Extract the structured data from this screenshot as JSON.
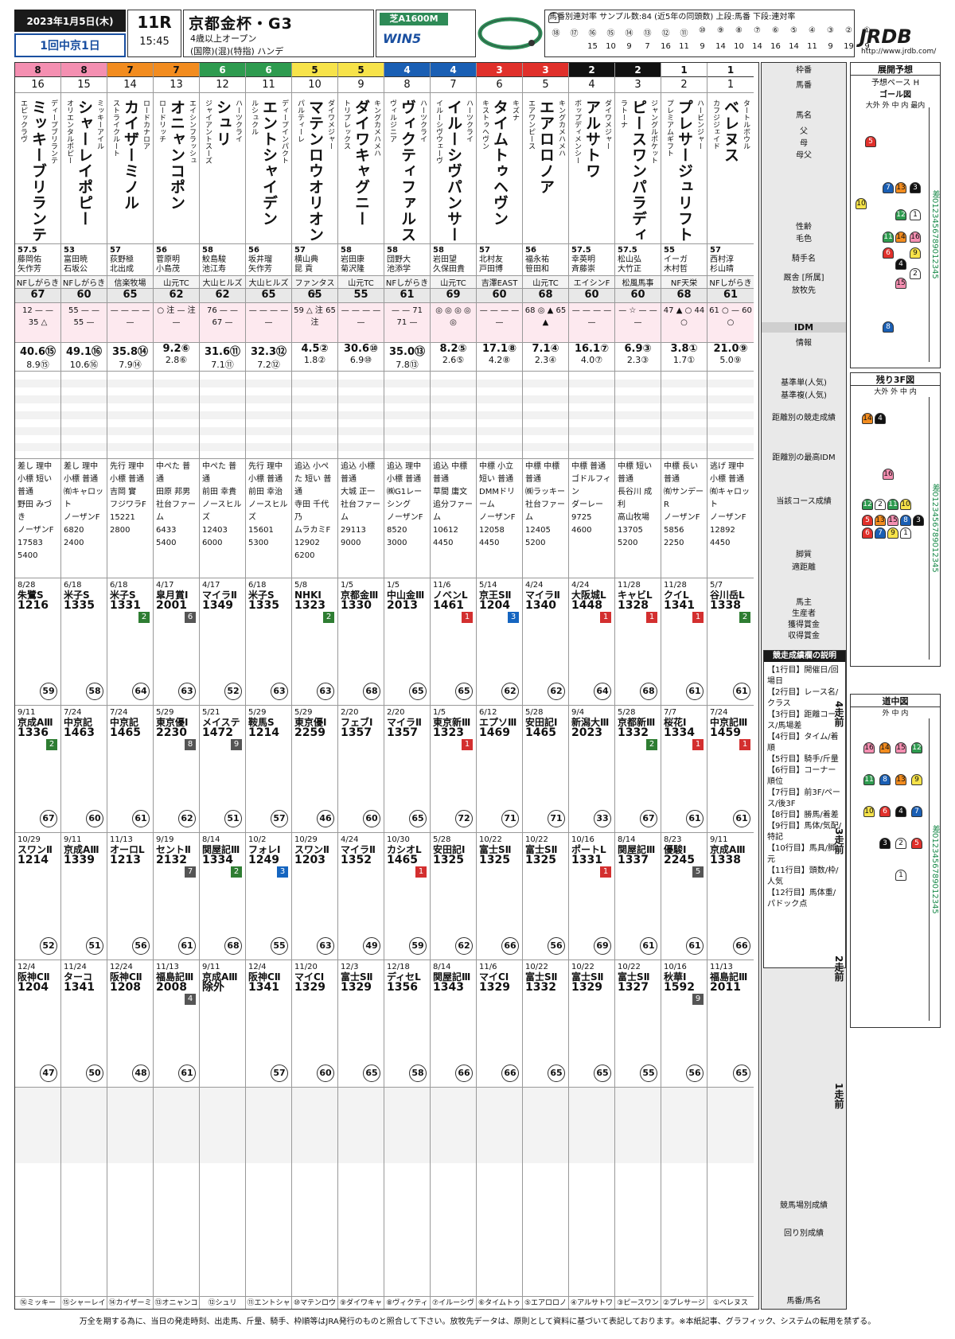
{
  "header": {
    "date": "2023年1月5日(木)",
    "venue": "1回中京1日",
    "race_no": "11R",
    "post_time": "15:45",
    "race_title": "京都金杯・G3",
    "conditions": "4歳以上オープン",
    "conditions2": "(国際)(混)(特指) ハンデ",
    "course": "芝A1600M",
    "win5": "WIN5",
    "stat_caption": "馬番別連対率 サンプル数:84 (近5年の同頭数) 上段:馬番 下段:連対率",
    "stat_nums": [
      "⑱",
      "⑰",
      "⑯",
      "⑮",
      "⑭",
      "⑬",
      "⑫",
      "⑪",
      "⑩",
      "⑨",
      "⑧",
      "⑦",
      "⑥",
      "⑤",
      "④",
      "③",
      "②",
      "①"
    ],
    "stat_vals": [
      "",
      "",
      "15",
      "10",
      "9",
      "7",
      "16",
      "11",
      "9",
      "14",
      "10",
      "14",
      "16",
      "14",
      "11",
      "9",
      "19",
      "9"
    ],
    "logo": "JRDB",
    "url": "http://www.jrdb.com/"
  },
  "horses": [
    {
      "waku": "8",
      "umaban": "16",
      "name": "ミッキーブリランテ",
      "sire": "ディープブリランテ",
      "dam": "エピックラヴ",
      "weight": "57.5",
      "jockey": "藤岡佑",
      "trainer": "矢作芳",
      "stable": "NFしがらき",
      "idm": "67",
      "marks": "12 — — 35 △",
      "odds_w": "40.6⑮",
      "odds_p": "8.9⑮",
      "style": "差し 理中 小標 短い 普通",
      "owner": "野田 みづき",
      "breeder": "ノーザンF",
      "earn1": "17583",
      "earn2": "5400",
      "short": "⑯ミッキー",
      "runs": [
        {
          "date": "8/28",
          "rn": "朱鷺S",
          "time": "1216",
          "pos": "",
          "idx": "59"
        },
        {
          "date": "9/11",
          "rn": "京成AⅢ",
          "time": "1336",
          "pos": "2",
          "idx": "67"
        },
        {
          "date": "10/29",
          "rn": "スワンⅡ",
          "time": "1214",
          "pos": "",
          "idx": "52"
        },
        {
          "date": "12/4",
          "rn": "阪神CⅡ",
          "time": "1204",
          "pos": "",
          "idx": "47"
        }
      ]
    },
    {
      "waku": "8",
      "umaban": "15",
      "name": "シャーレイポピー",
      "sire": "ミッキーアイル",
      "dam": "オリエンタルポピー",
      "weight": "53",
      "jockey": "富田暁",
      "trainer": "石坂公",
      "stable": "NFしがらき",
      "idm": "60",
      "marks": "55 — — 55 —",
      "odds_w": "49.1⑯",
      "odds_p": "10.6⑯",
      "style": "差し 理中 小標 普通",
      "owner": "㈲キャロット",
      "breeder": "ノーザンF",
      "earn1": "6820",
      "earn2": "2400",
      "short": "⑮シャーレイ",
      "runs": [
        {
          "date": "6/18",
          "rn": "米子S",
          "time": "1335",
          "pos": "",
          "idx": "58"
        },
        {
          "date": "7/24",
          "rn": "中京記",
          "time": "1463",
          "pos": "",
          "idx": "60"
        },
        {
          "date": "9/11",
          "rn": "京成AⅢ",
          "time": "1339",
          "pos": "",
          "idx": "51"
        },
        {
          "date": "11/24",
          "rn": "ターコ",
          "time": "1341",
          "pos": "",
          "idx": "50"
        }
      ]
    },
    {
      "waku": "7",
      "umaban": "14",
      "name": "カイザーミノル",
      "sire": "ロードカナロア",
      "dam": "ストライクルート",
      "weight": "57",
      "jockey": "荻野極",
      "trainer": "北出成",
      "stable": "信楽牧場",
      "idm": "65",
      "marks": "— — — — —",
      "odds_w": "35.8⑭",
      "odds_p": "7.9⑭",
      "style": "先行 理中 小標 普通",
      "owner": "吉岡 實",
      "breeder": "フジワラF",
      "earn1": "15221",
      "earn2": "2800",
      "short": "⑭カイザーミ",
      "runs": [
        {
          "date": "6/18",
          "rn": "米子S",
          "time": "1331",
          "pos": "2",
          "idx": "64"
        },
        {
          "date": "7/24",
          "rn": "中京記",
          "time": "1465",
          "pos": "",
          "idx": "61"
        },
        {
          "date": "11/13",
          "rn": "オーロL",
          "time": "1213",
          "pos": "",
          "idx": "56"
        },
        {
          "date": "12/24",
          "rn": "阪神CⅡ",
          "time": "1208",
          "pos": "",
          "idx": "48"
        }
      ]
    },
    {
      "waku": "7",
      "umaban": "13",
      "name": "オニャンコポン",
      "sire": "エイシンフラッシュ",
      "dam": "ロードリッチ",
      "weight": "56",
      "jockey": "菅原明",
      "trainer": "小島茂",
      "stable": "山元TC",
      "idm": "62",
      "marks": "○ 注 — 注 —",
      "odds_w": "9.2⑥",
      "odds_p": "2.8⑥",
      "style": "中ぺた 普通",
      "owner": "田原 邦男",
      "breeder": "社台ファーム",
      "earn1": "6433",
      "earn2": "5400",
      "short": "⑬オニャンコ",
      "runs": [
        {
          "date": "4/17",
          "rn": "皐月賞I",
          "time": "2001",
          "pos": "6",
          "idx": "63"
        },
        {
          "date": "5/29",
          "rn": "東京優I",
          "time": "2230",
          "pos": "8",
          "idx": "62"
        },
        {
          "date": "9/19",
          "rn": "セントⅡ",
          "time": "2132",
          "pos": "7",
          "idx": "61"
        },
        {
          "date": "11/13",
          "rn": "福島記Ⅲ",
          "time": "2008",
          "pos": "4",
          "idx": "61"
        }
      ]
    },
    {
      "waku": "6",
      "umaban": "12",
      "name": "シュリ",
      "sire": "ハーツクライ",
      "dam": "ジャイアントスーズ",
      "weight": "58",
      "jockey": "鮫島駿",
      "trainer": "池江寿",
      "stable": "大山ヒルズ",
      "idm": "62",
      "marks": "76 — — 67 —",
      "odds_w": "31.6⑪",
      "odds_p": "7.1⑪",
      "style": "中ぺた 普通",
      "owner": "前田 幸貴",
      "breeder": "ノースヒルズ",
      "earn1": "12403",
      "earn2": "6000",
      "short": "⑫シュリ",
      "runs": [
        {
          "date": "4/17",
          "rn": "マイラⅡ",
          "time": "1349",
          "pos": "",
          "idx": "52"
        },
        {
          "date": "5/21",
          "rn": "メイステ",
          "time": "1472",
          "pos": "9",
          "idx": "51"
        },
        {
          "date": "8/14",
          "rn": "関屋記Ⅲ",
          "time": "1334",
          "pos": "2",
          "idx": "68"
        },
        {
          "date": "9/11",
          "rn": "京成AⅢ",
          "time": "除外",
          "pos": "",
          "idx": ""
        }
      ]
    },
    {
      "waku": "6",
      "umaban": "11",
      "name": "エントシャイデン",
      "sire": "ディープインパクト",
      "dam": "ルシュクル",
      "weight": "56",
      "jockey": "坂井瑠",
      "trainer": "矢作芳",
      "stable": "大山ヒルズ",
      "idm": "65",
      "marks": "— — — — —",
      "odds_w": "32.3⑫",
      "odds_p": "7.2⑫",
      "style": "先行 理中 小標 普通",
      "owner": "前田 幸治",
      "breeder": "ノースヒルズ",
      "earn1": "15601",
      "earn2": "5300",
      "short": "⑪エントシャ",
      "runs": [
        {
          "date": "6/18",
          "rn": "米子S",
          "time": "1335",
          "pos": "",
          "idx": "63"
        },
        {
          "date": "5/29",
          "rn": "鞍馬S",
          "time": "1214",
          "pos": "",
          "idx": "57"
        },
        {
          "date": "10/2",
          "rn": "フォレI",
          "time": "1249",
          "pos": "3",
          "idx": "55"
        },
        {
          "date": "12/4",
          "rn": "阪神CⅡ",
          "time": "1341",
          "pos": "",
          "idx": "57"
        }
      ]
    },
    {
      "waku": "5",
      "umaban": "10",
      "name": "マテンロウオリオン",
      "sire": "ダイワメジャー",
      "dam": "パルティーレ",
      "weight": "57",
      "jockey": "横山典",
      "trainer": "昆 貢",
      "stable": "ファンタスト",
      "idm": "65",
      "marks": "59 △ 注 65 注",
      "odds_w": "4.5②",
      "odds_p": "1.8②",
      "style": "追込 小ぺた 短い 普通",
      "owner": "寺田 千代乃",
      "breeder": "ムラカミF",
      "earn1": "12902",
      "earn2": "6200",
      "short": "⑩マテンロウ",
      "runs": [
        {
          "date": "5/8",
          "rn": "NHKI",
          "time": "1323",
          "pos": "2",
          "idx": "63"
        },
        {
          "date": "5/29",
          "rn": "東京優I",
          "time": "2259",
          "pos": "",
          "idx": "46"
        },
        {
          "date": "10/29",
          "rn": "スワンⅡ",
          "time": "1203",
          "pos": "",
          "idx": "63"
        },
        {
          "date": "11/20",
          "rn": "マイCI",
          "time": "1329",
          "pos": "",
          "idx": "60"
        }
      ]
    },
    {
      "waku": "5",
      "umaban": "9",
      "name": "ダイワキャグニー",
      "sire": "キングカメハメハ",
      "dam": "トリプレックス",
      "weight": "58",
      "jockey": "岩田康",
      "trainer": "菊沢隆",
      "stable": "山元TC",
      "idm": "55",
      "marks": "— — — — —",
      "odds_w": "30.6⑩",
      "odds_p": "6.9⑩",
      "style": "追込 小標 普通",
      "owner": "大城 正一",
      "breeder": "社台ファーム",
      "earn1": "29113",
      "earn2": "9000",
      "short": "⑨ダイワキャ",
      "runs": [
        {
          "date": "1/5",
          "rn": "京都金Ⅲ",
          "time": "1330",
          "pos": "",
          "idx": "68"
        },
        {
          "date": "2/20",
          "rn": "フェブI",
          "time": "1357",
          "pos": "",
          "idx": "60"
        },
        {
          "date": "4/24",
          "rn": "マイラⅡ",
          "time": "1352",
          "pos": "",
          "idx": "49"
        },
        {
          "date": "12/3",
          "rn": "富士SⅡ",
          "time": "1329",
          "pos": "",
          "idx": "65"
        }
      ]
    },
    {
      "waku": "4",
      "umaban": "8",
      "name": "ヴィクティファルス",
      "sire": "ハーツクライ",
      "dam": "ヴィルジニア",
      "weight": "58",
      "jockey": "団野大",
      "trainer": "池添学",
      "stable": "NFしがらき",
      "idm": "61",
      "marks": "— — 71 71 —",
      "odds_w": "35.0⑬",
      "odds_p": "7.8⑬",
      "style": "追込 理中 小標 普通",
      "owner": "㈱G1レーシング",
      "breeder": "ノーザンF",
      "earn1": "8520",
      "earn2": "3000",
      "short": "⑧ヴィクティ",
      "runs": [
        {
          "date": "1/5",
          "rn": "中山金Ⅲ",
          "time": "2013",
          "pos": "",
          "idx": "65"
        },
        {
          "date": "2/20",
          "rn": "マイラⅡ",
          "time": "1357",
          "pos": "",
          "idx": "65"
        },
        {
          "date": "10/30",
          "rn": "カシオL",
          "time": "1465",
          "pos": "1",
          "idx": "59"
        },
        {
          "date": "12/18",
          "rn": "ディセL",
          "time": "1356",
          "pos": "",
          "idx": "58"
        }
      ]
    },
    {
      "waku": "4",
      "umaban": "7",
      "name": "イルーシヴパンサー",
      "sire": "ハーツクライ",
      "dam": "イルーシヴウェーヴ",
      "weight": "58",
      "jockey": "岩田望",
      "trainer": "久保田貴",
      "stable": "山元TC",
      "idm": "69",
      "marks": "◎ ◎ ◎ ◎ ◎",
      "odds_w": "8.2⑤",
      "odds_p": "2.6⑤",
      "style": "追込 中標 普通",
      "owner": "草間 庸文",
      "breeder": "追分ファーム",
      "earn1": "10612",
      "earn2": "4450",
      "short": "⑦イルーシヴ",
      "runs": [
        {
          "date": "11/6",
          "rn": "ノベンL",
          "time": "1461",
          "pos": "1",
          "idx": "65"
        },
        {
          "date": "1/5",
          "rn": "東京新Ⅲ",
          "time": "1323",
          "pos": "1",
          "idx": "72"
        },
        {
          "date": "5/28",
          "rn": "安田記I",
          "time": "1325",
          "pos": "",
          "idx": "62"
        },
        {
          "date": "8/14",
          "rn": "関屋記Ⅲ",
          "time": "1343",
          "pos": "",
          "idx": "66"
        }
      ]
    },
    {
      "waku": "3",
      "umaban": "6",
      "name": "タイムトゥヘヴン",
      "sire": "キズナ",
      "dam": "キストゥヘヴン",
      "weight": "57",
      "jockey": "北村友",
      "trainer": "戸田博",
      "stable": "吉澤EAST",
      "idm": "60",
      "marks": "— — — — —",
      "odds_w": "17.1⑧",
      "odds_p": "4.2⑧",
      "style": "中標 小立 短い 普通",
      "owner": "DMMドリーム",
      "breeder": "ノーザンF",
      "earn1": "12058",
      "earn2": "4450",
      "short": "⑥タイムトゥ",
      "runs": [
        {
          "date": "5/14",
          "rn": "京王SⅡ",
          "time": "1204",
          "pos": "3",
          "idx": "62"
        },
        {
          "date": "6/12",
          "rn": "エプソⅢ",
          "time": "1469",
          "pos": "",
          "idx": "71"
        },
        {
          "date": "10/22",
          "rn": "富士SⅡ",
          "time": "1325",
          "pos": "",
          "idx": "66"
        },
        {
          "date": "11/6",
          "rn": "マイCI",
          "time": "1329",
          "pos": "",
          "idx": "66"
        }
      ]
    },
    {
      "waku": "3",
      "umaban": "5",
      "name": "エアロロノア",
      "sire": "キングカメハメハ",
      "dam": "エアワンピース",
      "weight": "56",
      "jockey": "福永祐",
      "trainer": "笹田和",
      "stable": "山元TC",
      "idm": "68",
      "marks": "68 ◎ ▲ 65 ▲",
      "odds_w": "7.1④",
      "odds_p": "2.3④",
      "style": "中標 中標 普通",
      "owner": "㈱ラッキー",
      "breeder": "社台ファーム",
      "earn1": "12405",
      "earn2": "5200",
      "short": "⑤エアロロノ",
      "runs": [
        {
          "date": "4/24",
          "rn": "マイラⅡ",
          "time": "1340",
          "pos": "",
          "idx": "62"
        },
        {
          "date": "5/28",
          "rn": "安田記I",
          "time": "1465",
          "pos": "",
          "idx": "71"
        },
        {
          "date": "10/22",
          "rn": "富士SⅡ",
          "time": "1325",
          "pos": "",
          "idx": "56"
        },
        {
          "date": "10/22",
          "rn": "富士SⅡ",
          "time": "1332",
          "pos": "",
          "idx": "65"
        }
      ]
    },
    {
      "waku": "2",
      "umaban": "4",
      "name": "アルサトワ",
      "sire": "ダイワメジャー",
      "dam": "ボップディメンシー",
      "weight": "57.5",
      "jockey": "幸英明",
      "trainer": "斉藤崇",
      "stable": "エイシンF",
      "idm": "60",
      "marks": "— — — — —",
      "odds_w": "16.1⑦",
      "odds_p": "4.0⑦",
      "style": "中標 普通",
      "owner": "ゴドルフィン",
      "breeder": "ダーレー",
      "earn1": "9725",
      "earn2": "4600",
      "short": "④アルサトワ",
      "runs": [
        {
          "date": "4/24",
          "rn": "大阪城L",
          "time": "1448",
          "pos": "1",
          "idx": "64"
        },
        {
          "date": "9/4",
          "rn": "新潟大Ⅲ",
          "time": "2023",
          "pos": "",
          "idx": "33"
        },
        {
          "date": "10/16",
          "rn": "ポートL",
          "time": "1331",
          "pos": "1",
          "idx": "69"
        },
        {
          "date": "10/22",
          "rn": "富士SⅡ",
          "time": "1329",
          "pos": "",
          "idx": "65"
        }
      ]
    },
    {
      "waku": "2",
      "umaban": "3",
      "name": "ピースワンパラディ",
      "sire": "ジャングルポケット",
      "dam": "ラトーナ",
      "weight": "57.5",
      "jockey": "松山弘",
      "trainer": "大竹正",
      "stable": "松風馬事",
      "idm": "60",
      "marks": "— ☆ — — —",
      "odds_w": "6.9③",
      "odds_p": "2.3③",
      "style": "中標 短い 普通",
      "owner": "長谷川 成利",
      "breeder": "高山牧場",
      "earn1": "13705",
      "earn2": "5200",
      "short": "③ピースワン",
      "runs": [
        {
          "date": "11/28",
          "rn": "キャビL",
          "time": "1328",
          "pos": "1",
          "idx": "68"
        },
        {
          "date": "5/28",
          "rn": "京都新Ⅲ",
          "time": "1332",
          "pos": "2",
          "idx": "67"
        },
        {
          "date": "8/14",
          "rn": "関屋記Ⅲ",
          "time": "1337",
          "pos": "",
          "idx": "61"
        },
        {
          "date": "10/22",
          "rn": "富士SⅡ",
          "time": "1327",
          "pos": "",
          "idx": "55"
        }
      ]
    },
    {
      "waku": "1",
      "umaban": "2",
      "name": "プレサージュリフト",
      "sire": "ハービンジャー",
      "dam": "プレミアムギフト",
      "weight": "55",
      "jockey": "イーガ",
      "trainer": "木村哲",
      "stable": "NF天栄",
      "idm": "68",
      "marks": "47 ▲ ○ 44 ○",
      "odds_w": "3.8①",
      "odds_p": "1.7①",
      "style": "中標 長い 普通",
      "owner": "㈲サンデーR",
      "breeder": "ノーザンF",
      "earn1": "5856",
      "earn2": "2250",
      "short": "②プレサージ",
      "runs": [
        {
          "date": "11/28",
          "rn": "クイL",
          "time": "1341",
          "pos": "1",
          "idx": "61"
        },
        {
          "date": "7/7",
          "rn": "桜花I",
          "time": "1334",
          "pos": "1",
          "idx": "61"
        },
        {
          "date": "8/23",
          "rn": "優駿I",
          "time": "2245",
          "pos": "5",
          "idx": "61"
        },
        {
          "date": "10/16",
          "rn": "秋華I",
          "time": "1592",
          "pos": "9",
          "idx": "56"
        }
      ]
    },
    {
      "waku": "1",
      "umaban": "1",
      "name": "ベレヌス",
      "sire": "タートルボウル",
      "dam": "カフジジェイド",
      "weight": "57",
      "jockey": "西村淳",
      "trainer": "杉山晴",
      "stable": "NFしがらき",
      "idm": "61",
      "marks": "61 ○ — 60 ○",
      "odds_w": "21.0⑨",
      "odds_p": "5.0⑨",
      "style": "逃げ 理中 小標 普通",
      "owner": "㈲キャロット",
      "breeder": "ノーザンF",
      "earn1": "12892",
      "earn2": "4450",
      "short": "①ベレヌス",
      "runs": [
        {
          "date": "5/7",
          "rn": "谷川岳L",
          "time": "1338",
          "pos": "2",
          "idx": "61"
        },
        {
          "date": "7/24",
          "rn": "中京記Ⅲ",
          "time": "1459",
          "pos": "1",
          "idx": "61"
        },
        {
          "date": "9/11",
          "rn": "京成AⅢ",
          "time": "1338",
          "pos": "",
          "idx": "66"
        },
        {
          "date": "11/13",
          "rn": "福島記Ⅲ",
          "time": "2011",
          "pos": "",
          "idx": "65"
        }
      ]
    }
  ],
  "labels": {
    "waku": "枠番",
    "umaban": "馬番",
    "bamei": "馬名",
    "sire": "父",
    "dam": "母",
    "damsire": "母父",
    "sexage": "性齢",
    "color": "毛色",
    "jockey": "騎手名",
    "trainer": "厩舎 [所属]",
    "stable": "放牧先",
    "idm": "IDM",
    "info": "情報",
    "odds": "基準単(人気)",
    "odds2": "基準複(人気)",
    "dist": "距離別の競走成績",
    "dist2": "距離別の最高IDM",
    "course_rec": "当該コース成績",
    "style": "脚質",
    "fit": "適距離",
    "owner": "馬主",
    "breeder": "生産者",
    "earn": "獲得賞金",
    "earn2": "収得賞金",
    "explain_title": "競走成績欄の説明",
    "explain": [
      "【1行目】開催日/回場日",
      "【2行目】レース名/クラス",
      "【3行目】距離コース/馬場差",
      "【4行目】タイム/着順",
      "【5行目】騎手/斤量",
      "【6行目】コーナー順位",
      "【7行目】前3F/ペース/後3F",
      "【8行目】勝馬/着差",
      "【9行目】馬体/気配/特記",
      "【10行目】馬具/脚元",
      "【11行目】頭数/枠/人気",
      "【12行目】馬体重/パドック点"
    ],
    "run4": "4走前",
    "run3": "3走前",
    "run2": "2走前",
    "run1": "1走前",
    "totals": "競馬場別成績",
    "totals2": "回り別成績",
    "short": "馬番/馬名"
  },
  "panels": {
    "p1_title": "展開予想",
    "p1_sub": "予想ペース H",
    "p1_goal": "ゴール図",
    "p1_header": "大外 外 中 内 最内",
    "p2_title": "残り3F図",
    "p2_header": "大外 外 中 内",
    "p3_title": "道中図",
    "p3_header": "外 中 内",
    "ruler": "差0123456789012345"
  },
  "footer": "万全を期する為に、当日の発走時刻、出走馬、斤量、騎手、枠順等はJRA発行のものと照合して下さい。放牧先データは、原則として資料に基づいて表記しております。※本紙記事、グラフィック、システムの転用を禁ずる。"
}
